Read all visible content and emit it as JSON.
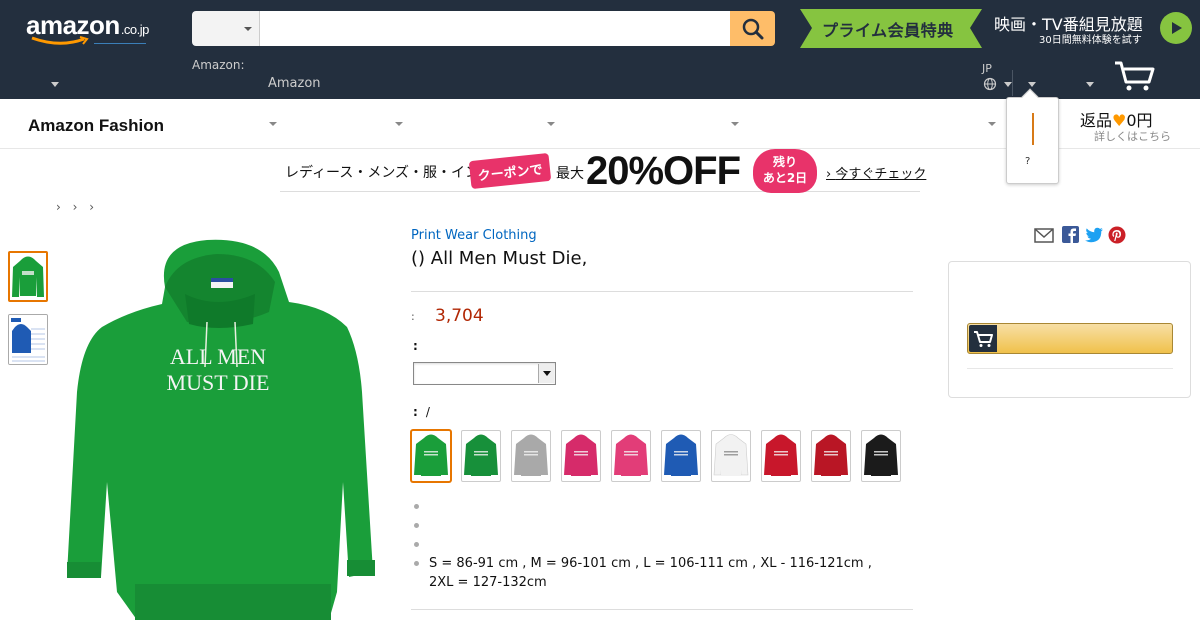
{
  "header": {
    "logo_text": "amazon",
    "logo_tld": ".co.jp",
    "search_placeholder": "",
    "prime_banner_text": "プライム会員特典",
    "video_line1": "映画・TV番組見放題",
    "video_line2": "30日間無料体験を試す",
    "nav_sub_left": "Amazon:",
    "nav_amazon": "Amazon",
    "lang": "JP"
  },
  "subnav": {
    "title": "Amazon Fashion",
    "return_text": "返品",
    "return_heart": "♥",
    "return_amount": "0円",
    "return_sub": "詳しくはこちら"
  },
  "popover": {
    "question": "?"
  },
  "promo": {
    "categories": "レディース・メンズ・服・インナー",
    "coupon": "クーポンで",
    "max": "最大",
    "discount": "20%OFF",
    "remain_line1": "残り",
    "remain_line2": "あと2日",
    "check": "今すぐチェック"
  },
  "breadcrumb": "› ›   ›",
  "product": {
    "brand": "Print Wear Clothing",
    "title": "() All Men Must Die,",
    "price_label": ":",
    "price": "3,704",
    "size_label": ":",
    "color_label": ":",
    "color_value": "/",
    "shirt_print": "ALL MEN MUST DIE",
    "bullets": [
      "",
      "",
      "",
      "S = 86-91 cm , M = 96-101 cm , L = 106-111 cm , XL - 116-121cm , 2XL = 127-132cm"
    ],
    "swatches": [
      {
        "name": "kelly-green",
        "color": "#1a9e3a"
      },
      {
        "name": "green",
        "color": "#17903a"
      },
      {
        "name": "grey",
        "color": "#a9a9a9"
      },
      {
        "name": "pink",
        "color": "#d62b6a"
      },
      {
        "name": "pink-2",
        "color": "#e23d78"
      },
      {
        "name": "royal-blue",
        "color": "#1f5bb4"
      },
      {
        "name": "white",
        "color": "#f2f2f2"
      },
      {
        "name": "red",
        "color": "#c8172b"
      },
      {
        "name": "red-2",
        "color": "#b91625"
      },
      {
        "name": "black",
        "color": "#1b1b1b"
      }
    ]
  },
  "colors": {
    "nav_bg": "#232f3e",
    "search_button": "#febd69",
    "prime_green": "#86c440",
    "link": "#0066c0",
    "price": "#b12704",
    "selected_border": "#e77600",
    "hoodie_green": "#1a9e3a"
  }
}
